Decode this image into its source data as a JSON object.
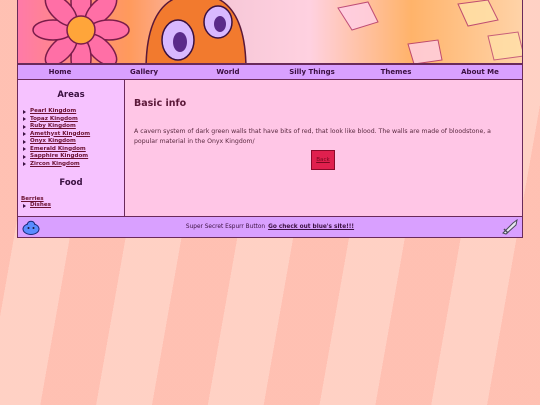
{
  "nav": [
    "Home",
    "Gallery",
    "World",
    "Silly Things",
    "Themes",
    "About Me"
  ],
  "sidebar": {
    "areas_heading": "Areas",
    "areas": [
      "Pearl Kingdom",
      "Topaz Kingdom",
      "Ruby Kingdom",
      "Amethyst Kingdom",
      "Onyx Kingdom",
      "Emerald Kingdom",
      "Sapphire Kingdom",
      "Zircon Kingdom"
    ],
    "food_heading": "Food",
    "food_link": "Berries",
    "food_items": [
      "Dishes"
    ]
  },
  "content": {
    "heading": "Basic info",
    "body": "A cavern system of dark green walls that have bits of red, that look like blood. The walls are made of bloodstone, a popular material in the Onyx Kingdom/",
    "back_label": "Back"
  },
  "footer": {
    "text": "Super Secret Espurr Button",
    "link": "Go check out blue's site!!!",
    "left_icon": "blue-slime-icon",
    "right_icon": "sword-icon"
  },
  "colors": {
    "nav_bg": "#d9a0ff",
    "sidebar_bg": "#f6c2ff",
    "content_bg": "#ffc6e6",
    "back_button": "#e0204e"
  }
}
